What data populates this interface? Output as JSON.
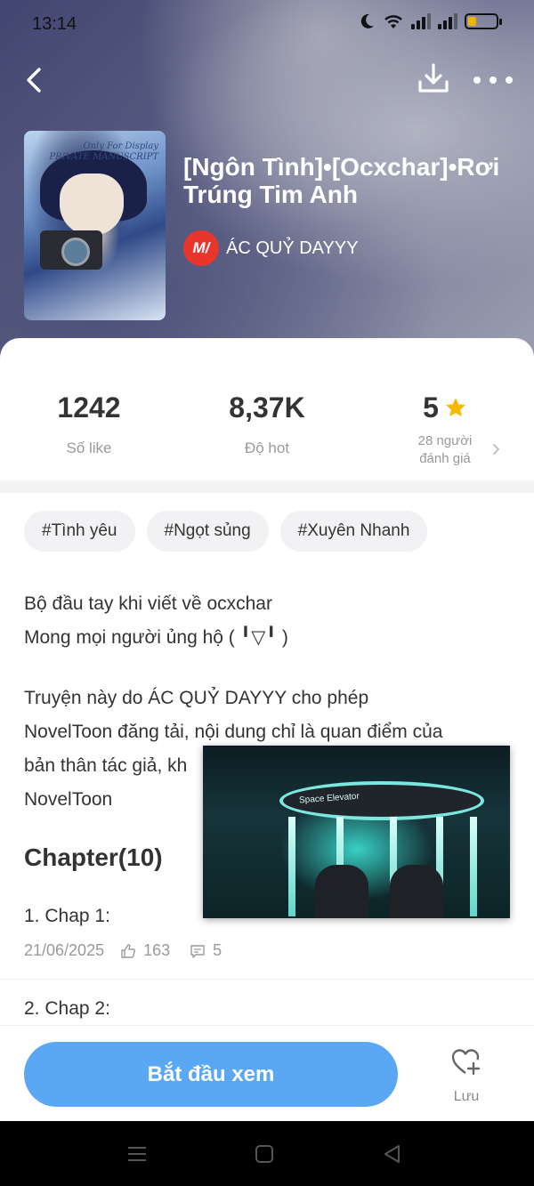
{
  "status_bar": {
    "time": "13:14"
  },
  "book": {
    "title": "[Ngôn Tình]•[Ocxchar]•Rơi Trúng Tim Anh",
    "author_badge": "M/",
    "author": "ÁC QUỶ DAYYY",
    "cover_text": "Only For Display\nPRIVATE MANUSCRIPT"
  },
  "stats": {
    "likes": {
      "value": "1242",
      "label": "Số like"
    },
    "hot": {
      "value": "8,37K",
      "label": "Độ hot"
    },
    "rating": {
      "value": "5",
      "line1": "28 người",
      "line2": "đánh giá"
    }
  },
  "tags": [
    "#Tình yêu",
    "#Ngọt sủng",
    "#Xuyên Nhanh"
  ],
  "description": {
    "line1": "Bộ đầu tay khi viết về ocxchar",
    "line2": "Mong mọi người ủng hộ ( ╹▽╹ )",
    "line3": "Truyện này do ÁC QUỶ DAYYY cho phép",
    "line4": "NovelToon đăng tải, nội dung chỉ là quan điểm của",
    "line5": "bản thân tác giả, kh",
    "line6": "NovelToon"
  },
  "video_overlay": {
    "label": "Space Elevator"
  },
  "chapters": {
    "heading": "Chapter(10)",
    "items": [
      {
        "title": "1. Chap 1:",
        "date": "21/06/2025",
        "likes": "163",
        "comments": "5"
      },
      {
        "title": "2. Chap 2:"
      }
    ]
  },
  "actions": {
    "start_label": "Bắt đầu xem",
    "save_label": "Lưu"
  },
  "colors": {
    "accent": "#5aa8f3",
    "star": "#f6b800",
    "author_badge": "#e8362c"
  }
}
